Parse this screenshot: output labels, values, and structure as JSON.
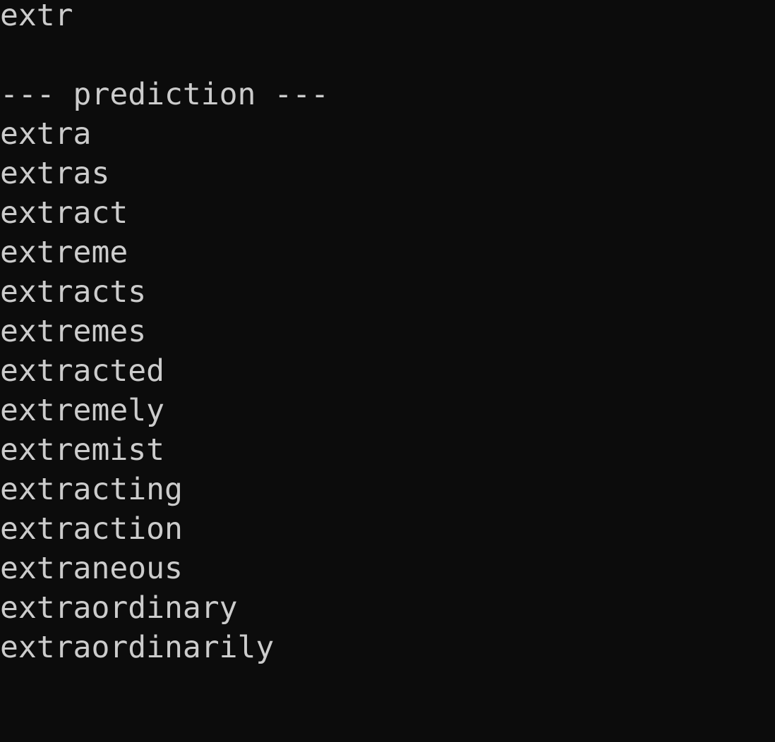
{
  "terminal": {
    "input": "extr",
    "separator": "--- prediction ---",
    "predictions": [
      "extra",
      "extras",
      "extract",
      "extreme",
      "extracts",
      "extremes",
      "extracted",
      "extremely",
      "extremist",
      "extracting",
      "extraction",
      "extraneous",
      "extraordinary",
      "extraordinarily"
    ]
  }
}
